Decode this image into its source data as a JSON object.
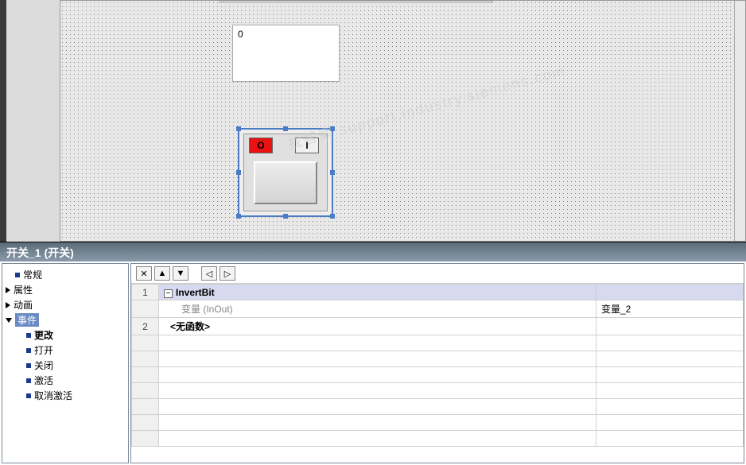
{
  "canvas": {
    "iofield_value": "0",
    "switch": {
      "led_on": "O",
      "led_off": "I"
    }
  },
  "watermark": "找答案 support.industry.siemens.com",
  "title": "开关_1 (开关)",
  "tree": {
    "general": "常规",
    "properties": "属性",
    "animations": "动画",
    "events": "事件",
    "event_items": {
      "change": "更改",
      "open": "打开",
      "close": "关闭",
      "activate": "激活",
      "deactivate": "取消激活"
    }
  },
  "toolbar": {
    "delete": "✕",
    "up": "▲",
    "down": "▼",
    "outdent": "◁",
    "indent": "▷"
  },
  "grid": {
    "row1_num": "1",
    "row1_func": "InvertBit",
    "row_param_label": "变量 (InOut)",
    "row_param_value": "变量_2",
    "row2_num": "2",
    "row2_func": "<无函数>"
  }
}
